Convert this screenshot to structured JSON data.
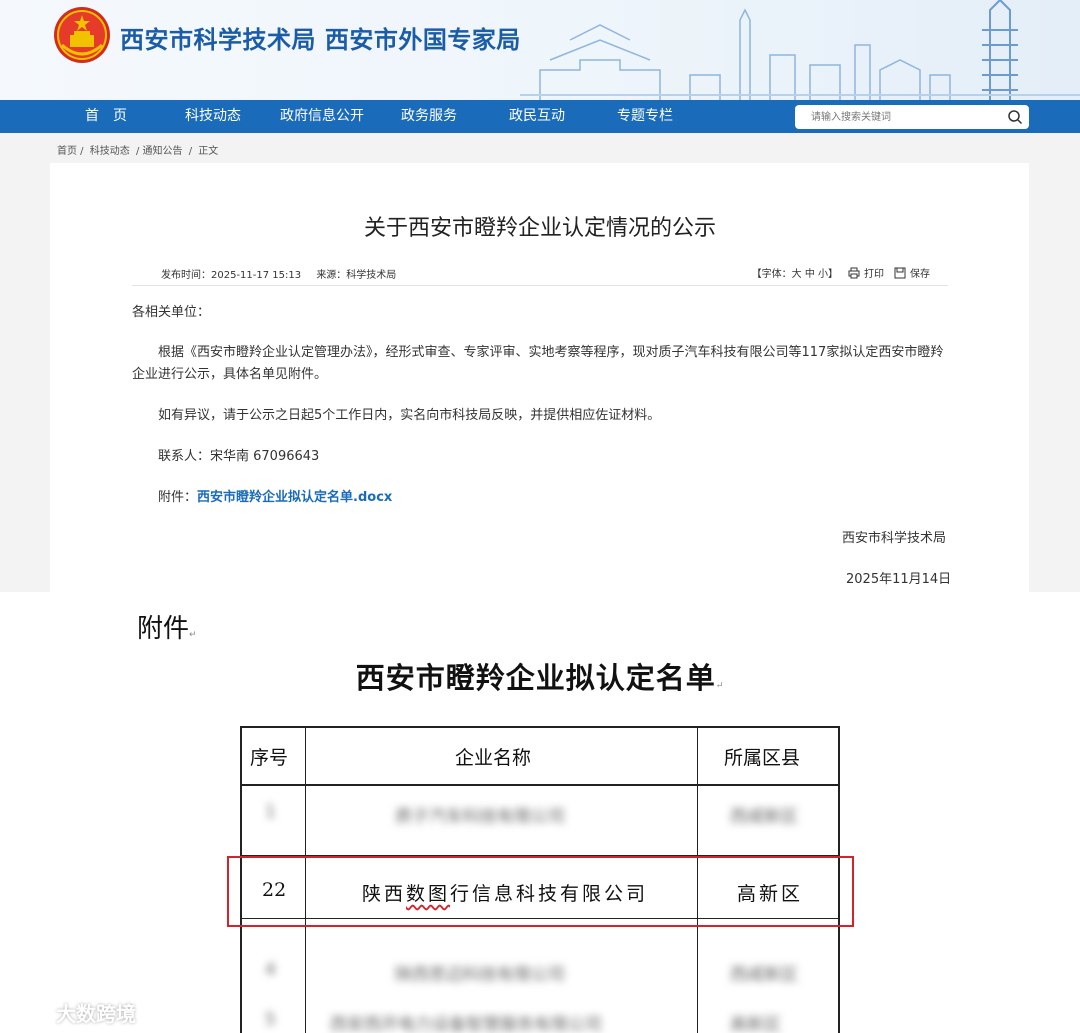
{
  "header": {
    "site_title": "西安市科学技术局  西安市外国专家局"
  },
  "nav": {
    "items": [
      "首　页",
      "科技动态",
      "政府信息公开",
      "政务服务",
      "政民互动",
      "专题专栏"
    ],
    "search_placeholder": "请输入搜索关键词"
  },
  "breadcrumb": [
    "首页 /",
    "科技动态",
    "/ 通知公告",
    "/",
    "正文"
  ],
  "article": {
    "title": "关于西安市瞪羚企业认定情况的公示",
    "publish_time": "发布时间：2025-11-17 15:13",
    "source": "来源：科学技术局",
    "font_size": "【字体：大 中 小】",
    "print_label": "打印",
    "save_label": "保存",
    "salutation": "各相关单位：",
    "body1": "根据《西安市瞪羚企业认定管理办法》，经形式审查、专家评审、实地考察等程序，现对质子汽车科技有限公司等117家拟认定西安市瞪羚企业进行公示，具体名单见附件。",
    "body2": "如有异议，请于公示之日起5个工作日内，实名向市科技局反映，并提供相应佐证材料。",
    "contact": "联系人：宋华南 67096643",
    "attachment_prefix": "附件：",
    "attachment_link": "西安市瞪羚企业拟认定名单.docx",
    "sign_org": "西安市科学技术局",
    "sign_date": "2025年11月14日"
  },
  "document": {
    "attach_label": "附件",
    "title": "西安市瞪羚企业拟认定名单",
    "headers": [
      "序号",
      "企业名称",
      "所属区县"
    ],
    "rows": [
      {
        "no": "1",
        "name": "质子汽车科技有限公司",
        "district": "西咸新区",
        "blurred": true
      },
      {
        "no": "22",
        "name": "陕西数图行信息科技有限公司",
        "district": "高新区",
        "blurred": false
      },
      {
        "no": "4",
        "name": "陕西思迈科技有限公司",
        "district": "西咸新区",
        "blurred": true
      },
      {
        "no": "5",
        "name": "西安西开电力设备智慧服务有限公司",
        "district": "高新区",
        "blurred": true
      }
    ]
  },
  "watermark": {
    "text": "大数跨境"
  },
  "colors": {
    "nav_blue": "#1a6bb9",
    "title_blue": "#1b5ca8",
    "highlight_red": "#d6232a"
  }
}
